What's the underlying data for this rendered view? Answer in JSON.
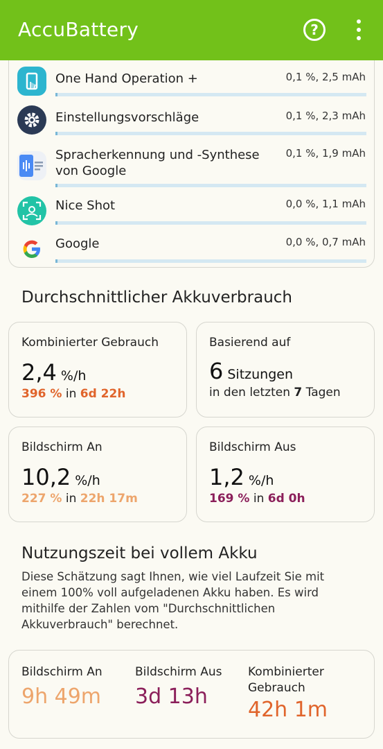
{
  "app_title": "AccuBattery",
  "colors": {
    "appbar": "#72c11a",
    "combined": "#e0642b",
    "screen_on": "#eda56c",
    "screen_off": "#8b1f5a",
    "usage_bar_track": "#d4e8f2",
    "usage_bar_fill": "#79b7d6"
  },
  "icons": {
    "help": "help-circle-icon",
    "more": "more-vert-icon"
  },
  "apps": [
    {
      "name": "One Hand Operation +",
      "usage": "0,1 %, 2,5 mAh",
      "percent": 0.1,
      "icon": "one-hand-operation-icon"
    },
    {
      "name": "Einstellungsvorschläge",
      "usage": "0,1 %, 2,3 mAh",
      "percent": 0.1,
      "icon": "settings-suggestions-icon"
    },
    {
      "name": "Spracherkennung und -Synthese von Google",
      "usage": "0,1 %, 1,9 mAh",
      "percent": 0.1,
      "icon": "speech-services-icon"
    },
    {
      "name": "Nice Shot",
      "usage": "0,0 %, 1,1 mAh",
      "percent": 0.0,
      "icon": "nice-shot-icon"
    },
    {
      "name": "Google",
      "usage": "0,0 %, 0,7 mAh",
      "percent": 0.0,
      "icon": "google-icon"
    }
  ],
  "avg_section": {
    "title": "Durchschnittlicher Akkuverbrauch",
    "combined": {
      "label": "Kombinierter Gebrauch",
      "value": "2,4",
      "unit": "%/h",
      "sub_pct": "396 %",
      "sub_in": "in",
      "sub_time": "6d 22h"
    },
    "based_on": {
      "label": "Basierend auf",
      "value": "6",
      "unit": "Sitzungen",
      "sub_pre": "in den letzten",
      "sub_num": "7",
      "sub_post": "Tagen"
    },
    "screen_on": {
      "label": "Bildschirm An",
      "value": "10,2",
      "unit": "%/h",
      "sub_pct": "227 %",
      "sub_in": "in",
      "sub_time": "22h 17m"
    },
    "screen_off": {
      "label": "Bildschirm Aus",
      "value": "1,2",
      "unit": "%/h",
      "sub_pct": "169 %",
      "sub_in": "in",
      "sub_time": "6d 0h"
    }
  },
  "full_section": {
    "title": "Nutzungszeit bei vollem Akku",
    "description": "Diese Schätzung sagt Ihnen, wie viel Laufzeit Sie mit einem 100% voll aufgeladenen Akku haben. Es wird mithilfe der Zahlen vom \"Durchschnittlichen Akkuverbrauch\" berechnet.",
    "screen_on": {
      "label": "Bildschirm An",
      "value": "9h 49m"
    },
    "screen_off": {
      "label": "Bildschirm Aus",
      "value": "3d 13h"
    },
    "combined": {
      "label": "Kombinierter Gebrauch",
      "value": "42h 1m"
    }
  }
}
